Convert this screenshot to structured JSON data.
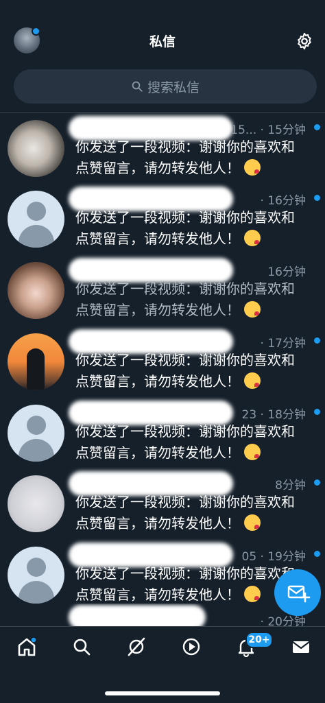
{
  "header": {
    "title": "私信"
  },
  "search": {
    "placeholder": "搜索私信"
  },
  "conversations": [
    {
      "avatar": "dog-plush-avatar",
      "time_prefix": "15...",
      "time": "· 15分钟",
      "message_line1": "你发送了一段视频：谢谢你的喜欢和",
      "message_line2": "点赞留言，请勿转发他人！",
      "emoji": "face-blowing-a-kiss",
      "unread": true
    },
    {
      "avatar": "default-avatar",
      "time_prefix": "",
      "time": "· 16分钟",
      "message_line1": "你发送了一段视频：谢谢你的喜欢和",
      "message_line2": "点赞留言，请勿转发他人！",
      "emoji": "face-blowing-a-kiss",
      "unread": true
    },
    {
      "avatar": "anime-girl-avatar",
      "time_prefix": "",
      "time": "16分钟",
      "message_line1": "你发送了一段视频：谢谢你的喜欢和",
      "message_line2": "点赞留言，请勿转发他人！",
      "emoji": "face-blowing-a-kiss",
      "unread": false
    },
    {
      "avatar": "sunset-person-avatar",
      "time_prefix": "",
      "time": "· 17分钟",
      "message_line1": "你发送了一段视频：谢谢你的喜欢和",
      "message_line2": "点赞留言，请勿转发他人！",
      "emoji": "face-blowing-a-kiss",
      "unread": true
    },
    {
      "avatar": "default-avatar",
      "time_prefix": "23",
      "time": "· 18分钟",
      "message_line1": "你发送了一段视频：谢谢你的喜欢和",
      "message_line2": "点赞留言，请勿转发他人！",
      "emoji": "face-blowing-a-kiss",
      "unread": true
    },
    {
      "avatar": "sketch-avatar",
      "time_prefix": "",
      "time": "8分钟",
      "message_line1": "你发送了一段视频：谢谢你的喜欢和",
      "message_line2": "点赞留言，请勿转发他人！",
      "emoji": "face-blowing-a-kiss",
      "unread": true
    },
    {
      "avatar": "default-avatar",
      "time_prefix": "05",
      "time": "· 19分钟",
      "message_line1": "你发送了一段视频：谢谢你的喜欢和",
      "message_line2": "点赞留言，请勿转发他人！",
      "emoji": "face-blowing-a-kiss",
      "unread": true
    },
    {
      "avatar": "default-avatar",
      "time_prefix": "",
      "time": "· 20分钟",
      "message_line1": "",
      "message_line2": "",
      "emoji": "",
      "unread": false
    }
  ],
  "tabbar": {
    "tabs": [
      "home-icon",
      "search-icon",
      "spaces-icon",
      "play-icon",
      "bell-icon",
      "mail-icon"
    ],
    "notification_badge": "20+"
  },
  "colors": {
    "background": "#15202b",
    "accent": "#1d9bf0",
    "muted": "#8b98a5",
    "divider": "#38444d"
  }
}
